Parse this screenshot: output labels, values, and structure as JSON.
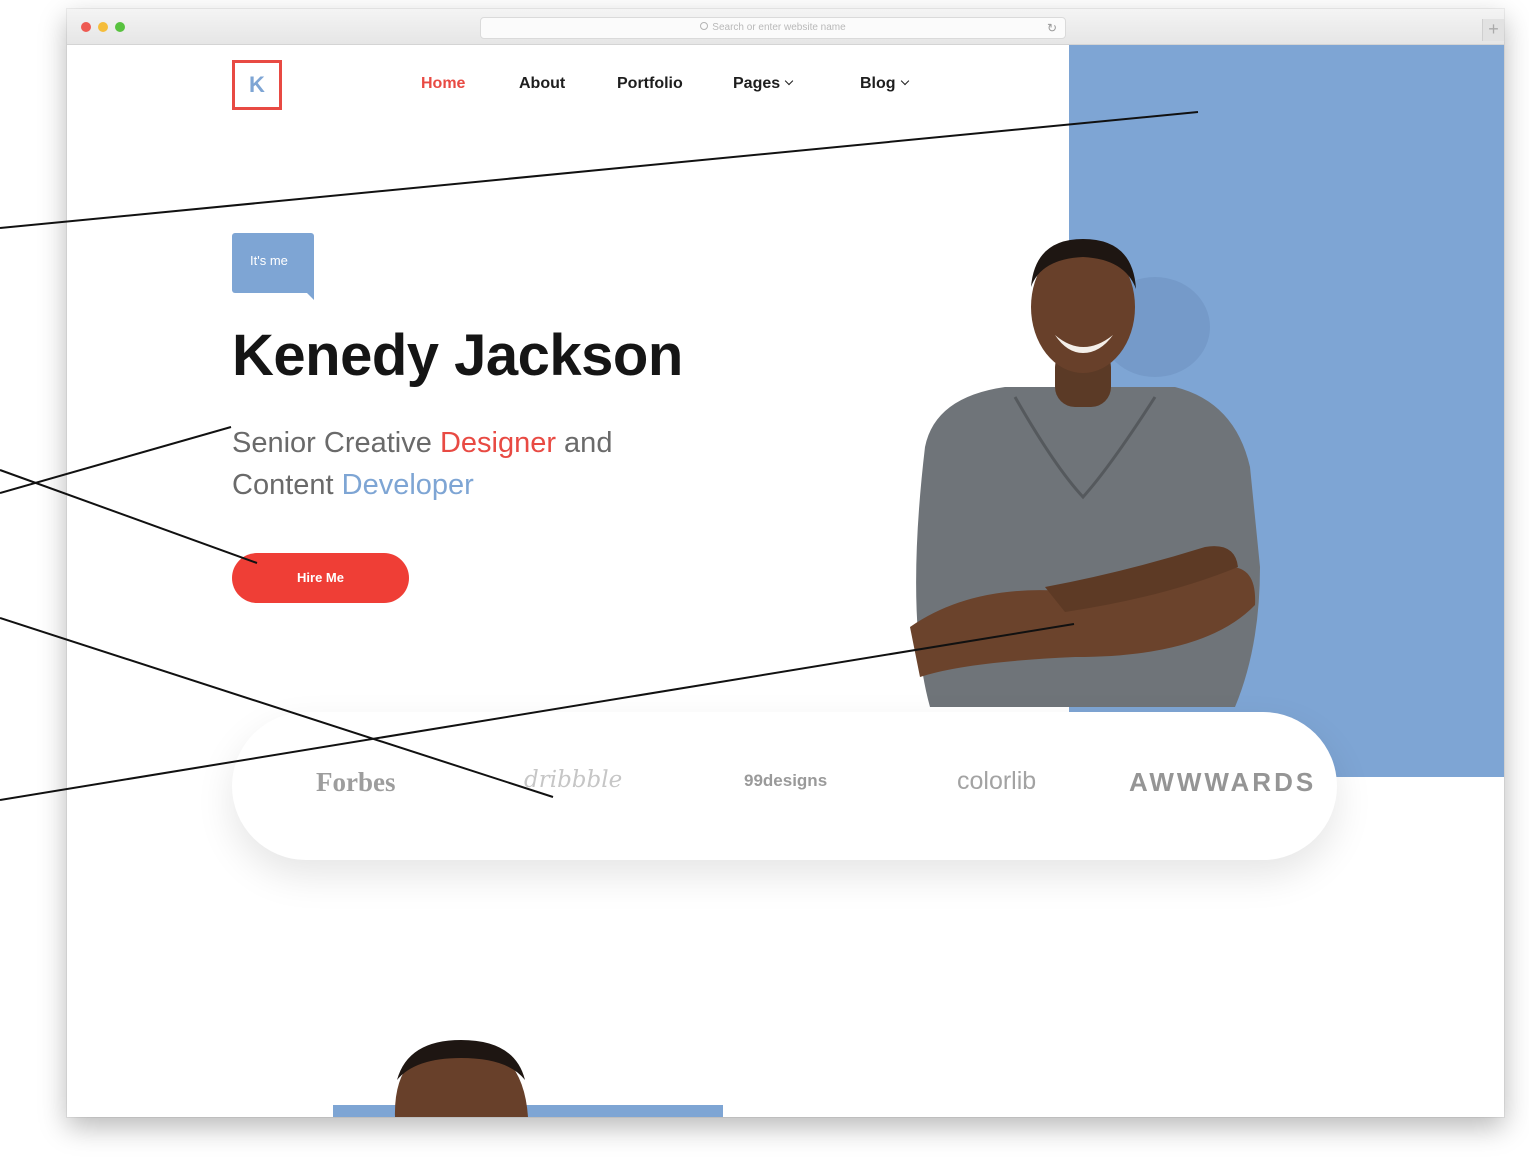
{
  "browser": {
    "address_placeholder": "Search or enter website name",
    "reload_icon": "reload-icon",
    "new_tab_label": "+"
  },
  "site": {
    "logo_letter": "K",
    "nav": [
      {
        "label": "Home",
        "active": true
      },
      {
        "label": "About"
      },
      {
        "label": "Portfolio"
      },
      {
        "label": "Pages",
        "has_dropdown": true
      },
      {
        "label": "Blog",
        "has_dropdown": true
      }
    ]
  },
  "hero": {
    "badge": "It's me",
    "name": "Kenedy Jackson",
    "subtitle_part1": "Senior Creative ",
    "subtitle_highlight1": "Designer",
    "subtitle_part2": " and",
    "subtitle_part3": "Content ",
    "subtitle_highlight2": "Developer",
    "cta_label": "Hire Me"
  },
  "brands": [
    "Forbes",
    "dribbble",
    "99designs",
    "colorlib",
    "AWWWARDS"
  ],
  "colors": {
    "accent_red": "#ef3e36",
    "accent_blue": "#7ea5d4",
    "text_dark": "#151515"
  }
}
